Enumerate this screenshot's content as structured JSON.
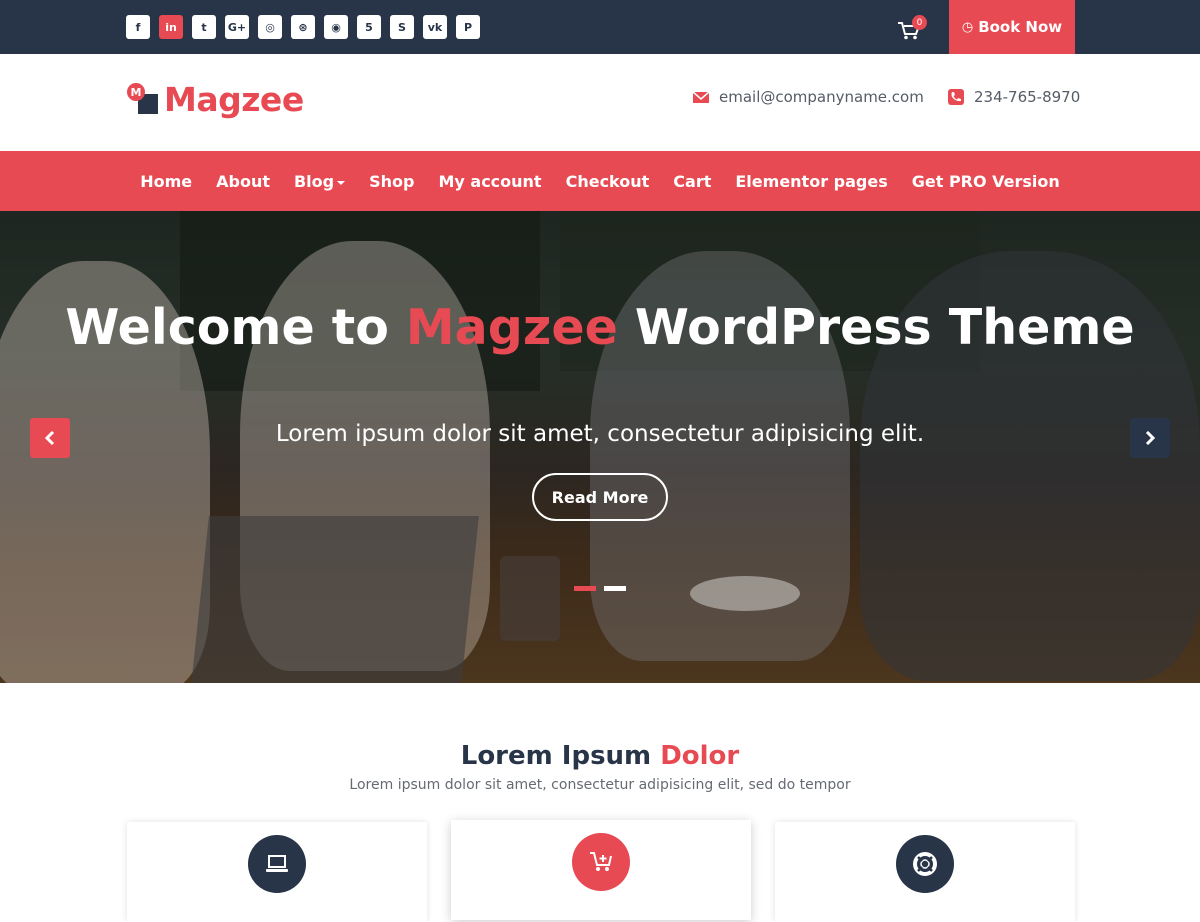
{
  "topbar": {
    "socials": [
      {
        "icon": "facebook-icon",
        "glyph": "f",
        "active": false
      },
      {
        "icon": "linkedin-icon",
        "glyph": "in",
        "active": true
      },
      {
        "icon": "twitter-icon",
        "glyph": "t",
        "active": false
      },
      {
        "icon": "google-plus-icon",
        "glyph": "G+",
        "active": false
      },
      {
        "icon": "instagram-icon",
        "glyph": "◎",
        "active": false
      },
      {
        "icon": "dribbble-icon",
        "glyph": "⊛",
        "active": false
      },
      {
        "icon": "github-icon",
        "glyph": "◉",
        "active": false
      },
      {
        "icon": "html5-icon",
        "glyph": "5",
        "active": false
      },
      {
        "icon": "skype-icon",
        "glyph": "S",
        "active": false
      },
      {
        "icon": "vk-icon",
        "glyph": "vk",
        "active": false
      },
      {
        "icon": "pinterest-icon",
        "glyph": "P",
        "active": false
      }
    ],
    "cart_count": "0",
    "book_now_label": "Book Now"
  },
  "header": {
    "logo_text": "Magzee",
    "email": "email@companyname.com",
    "phone": "234-765-8970"
  },
  "nav": {
    "items": [
      {
        "label": "Home",
        "dropdown": false
      },
      {
        "label": "About",
        "dropdown": false
      },
      {
        "label": "Blog",
        "dropdown": true
      },
      {
        "label": "Shop",
        "dropdown": false
      },
      {
        "label": "My account",
        "dropdown": false
      },
      {
        "label": "Checkout",
        "dropdown": false
      },
      {
        "label": "Cart",
        "dropdown": false
      },
      {
        "label": "Elementor pages",
        "dropdown": false
      },
      {
        "label": "Get PRO Version",
        "dropdown": false
      }
    ]
  },
  "hero": {
    "title_part1": "Welcome to ",
    "title_accent": "Magzee",
    "title_part2": " WordPress Theme",
    "subtitle": "Lorem ipsum dolor sit amet, consectetur adipisicing elit.",
    "button_label": "Read More"
  },
  "section": {
    "title_main": "Lorem Ipsum ",
    "title_accent": "Dolor",
    "subtitle": "Lorem ipsum dolor sit amet, consectetur adipisicing elit, sed do tempor",
    "cards": [
      {
        "icon": "laptop-icon",
        "color": "#283447"
      },
      {
        "icon": "cart-add-icon",
        "color": "#e84a53"
      },
      {
        "icon": "lifebuoy-icon",
        "color": "#283447"
      }
    ]
  },
  "colors": {
    "accent": "#e84a53",
    "dark": "#283447"
  }
}
